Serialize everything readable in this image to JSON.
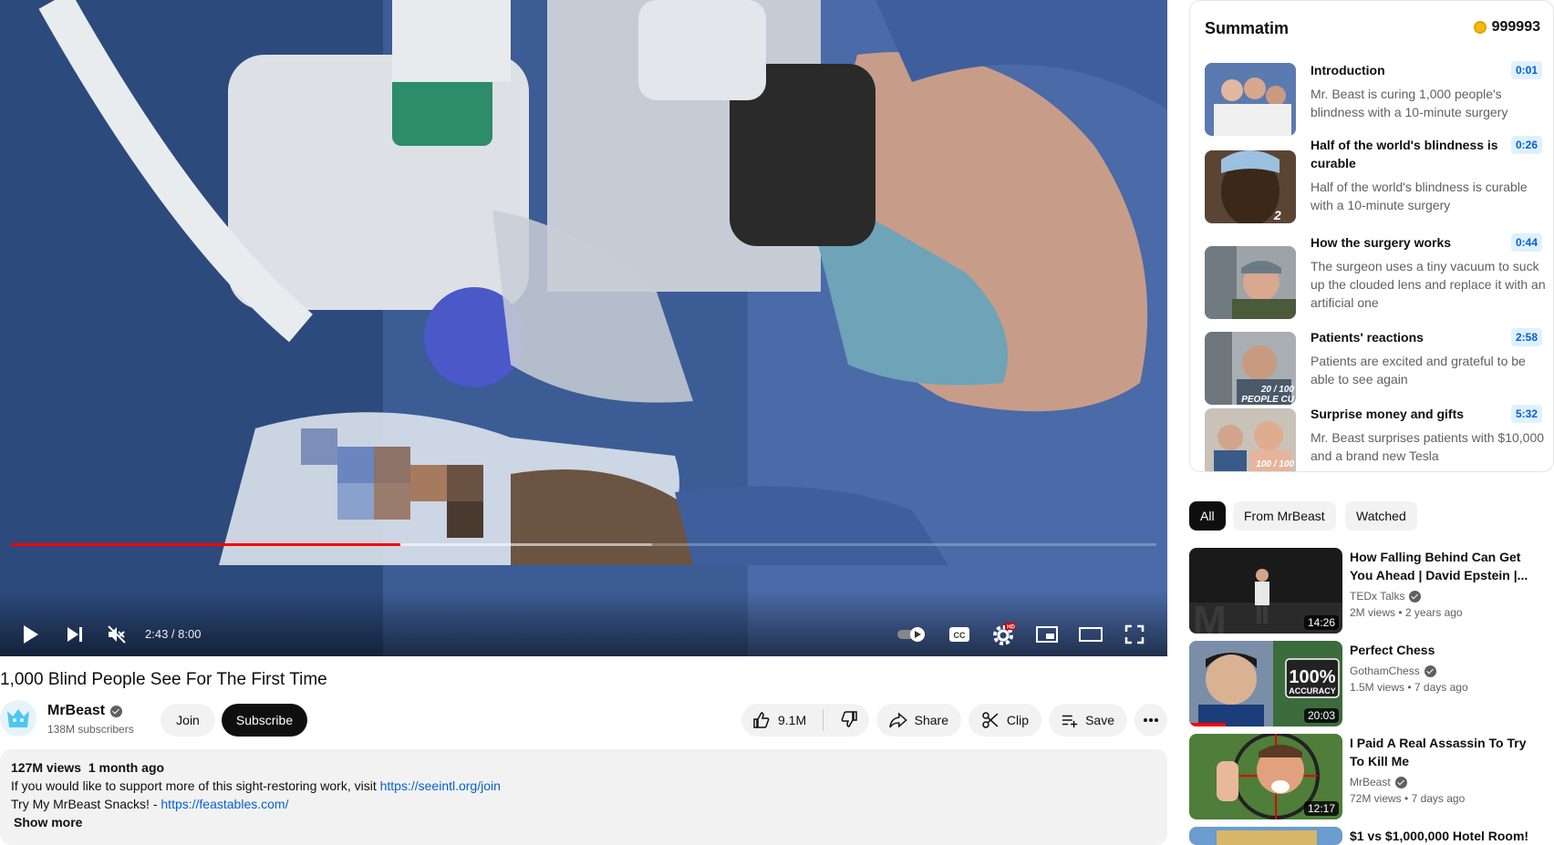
{
  "player": {
    "time": "2:43 / 8:00",
    "progress_played": 0.34,
    "progress_buffered": 0.56,
    "hd_badge": "HD",
    "cc_label": "CC"
  },
  "video": {
    "title": "1,000 Blind People See For The First Time",
    "channel": "MrBeast",
    "subscribers": "138M subscribers",
    "join_label": "Join",
    "subscribe_label": "Subscribe",
    "likes": "9.1M",
    "share_label": "Share",
    "clip_label": "Clip",
    "save_label": "Save"
  },
  "description": {
    "views": "127M views",
    "age": "1 month ago",
    "line1_text": "If you would like to support more of this sight-restoring work, visit ",
    "line1_link": "https://seeintl.org/join",
    "line2_text": "Try My MrBeast Snacks! - ",
    "line2_link": "https://feastables.com/",
    "show_more": "Show more"
  },
  "summatim": {
    "title": "Summatim",
    "coins": "999993",
    "chapters": [
      {
        "title": "Introduction",
        "time": "0:01",
        "text": "Mr. Beast is curing 1,000 people's blindness with a 10-minute surgery",
        "thumb_caption": ""
      },
      {
        "title": "Half of the world's blindness is curable",
        "time": "0:26",
        "text": "Half of the world's blindness is curable with a 10-minute surgery",
        "thumb_caption": "2"
      },
      {
        "title": "How the surgery works",
        "time": "0:44",
        "text": "The surgeon uses a tiny vacuum to suck up the clouded lens and replace it with an artificial one",
        "thumb_caption": ""
      },
      {
        "title": "Patients' reactions",
        "time": "2:58",
        "text": "Patients are excited and grateful to be able to see again",
        "thumb_caption": "20 / 100 PEOPLE CU"
      },
      {
        "title": "Surprise money and gifts",
        "time": "5:32",
        "text": "Mr. Beast surprises patients with $10,000 and a brand new Tesla",
        "thumb_caption": "100 / 100"
      }
    ]
  },
  "chips": [
    "All",
    "From MrBeast",
    "Watched"
  ],
  "recommendations": [
    {
      "title": "How Falling Behind Can Get You Ahead | David Epstein |...",
      "channel": "TEDx Talks",
      "views": "2M views",
      "age": "2 years ago",
      "duration": "14:26",
      "thumb_text": ""
    },
    {
      "title": "Perfect Chess",
      "channel": "GothamChess",
      "views": "1.5M views",
      "age": "7 days ago",
      "duration": "20:03",
      "thumb_text": "100%",
      "thumb_sub": "ACCURACY"
    },
    {
      "title": "I Paid A Real Assassin To Try To Kill Me",
      "channel": "MrBeast",
      "views": "72M views",
      "age": "7 days ago",
      "duration": "12:17",
      "thumb_text": ""
    },
    {
      "title": "$1 vs $1,000,000 Hotel Room!",
      "channel": "",
      "views": "",
      "age": "",
      "duration": "",
      "thumb_text": ""
    }
  ],
  "colors": {
    "accent_red": "#ff0000",
    "link_blue": "#065fd4",
    "chip_bg": "#f2f2f2"
  },
  "icons": [
    "play-icon",
    "next-icon",
    "mute-icon",
    "autoplay-toggle-icon",
    "captions-icon",
    "settings-icon",
    "miniplayer-icon",
    "theater-icon",
    "fullscreen-icon",
    "like-icon",
    "dislike-icon",
    "share-icon",
    "clip-icon",
    "save-icon",
    "more-icon",
    "coin-icon",
    "verified-icon"
  ]
}
